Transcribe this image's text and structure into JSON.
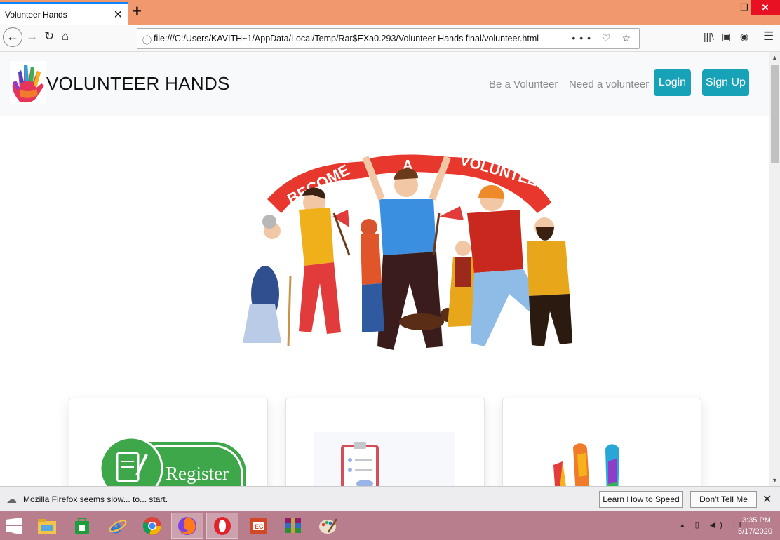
{
  "browser": {
    "tab_title": "Volunteer Hands",
    "tab_close": "✕",
    "new_tab": "+",
    "url": "file:///C:/Users/KAVITH~1/AppData/Local/Temp/Rar$EXa0.293/Volunteer Hands final/volunteer.html",
    "window_controls": {
      "minimize": "–",
      "maximize": "❐",
      "close": "✕"
    }
  },
  "site": {
    "brand": "VOLUNTEER HANDS",
    "nav": {
      "be_volunteer": "Be a Volunteer",
      "need_volunteer": "Need a volunteer",
      "login": "Login",
      "signup": "Sign Up"
    },
    "hero": {
      "banner_word_1": "BECOME",
      "banner_word_2": "A",
      "banner_word_3": "VOLUNTEER"
    },
    "cards": [
      {
        "label": "Register"
      },
      {
        "label": ""
      },
      {
        "label": ""
      }
    ],
    "accent_color": "#17a2b8"
  },
  "notification": {
    "message": "Mozilla Firefox seems slow... to... start.",
    "learn_button": "Learn How to Speed It Up",
    "dismiss_button": "Don't Tell Me Again"
  },
  "taskbar": {
    "time": "3:35 PM",
    "date": "5/17/2020"
  }
}
